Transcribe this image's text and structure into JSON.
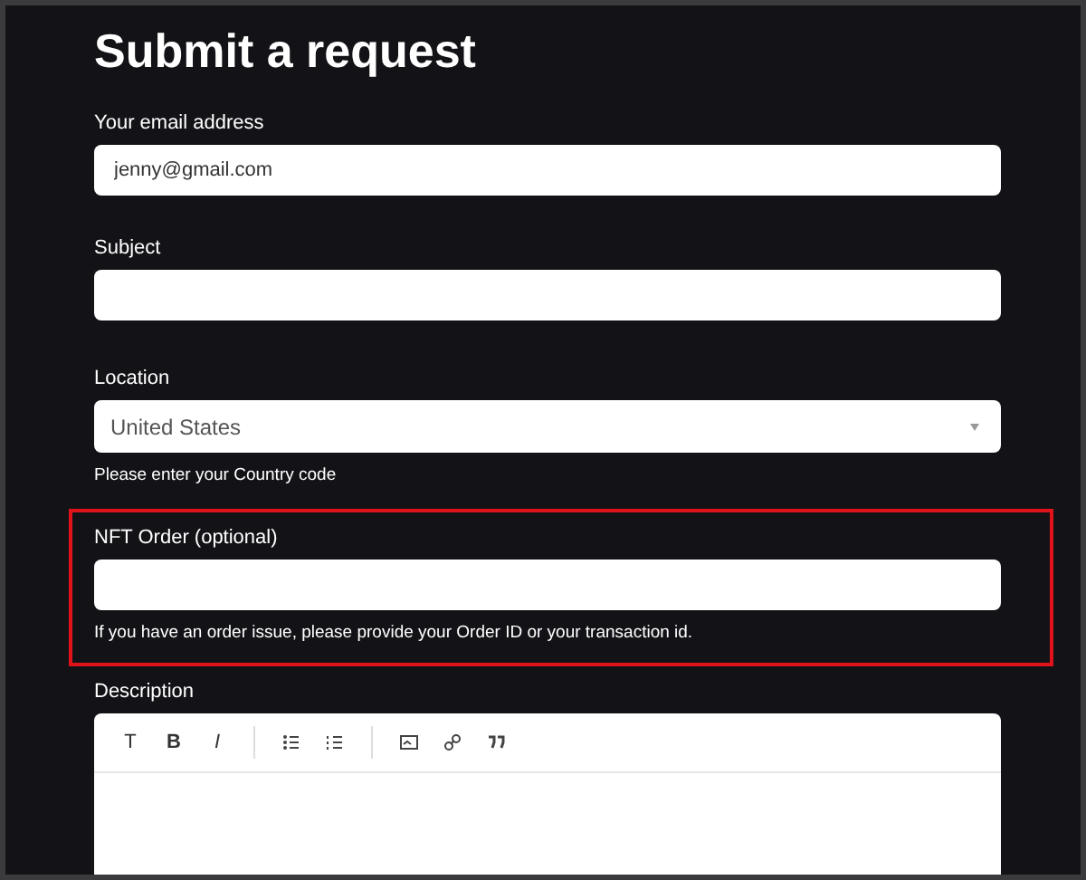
{
  "title": "Submit a request",
  "fields": [
    {
      "kind": "input",
      "label": "Your email address",
      "value": "jenny@gmail.com",
      "highlighted": false
    },
    {
      "kind": "input",
      "label": "Subject",
      "highlighted": false
    },
    {
      "kind": "select",
      "label": "Location",
      "value": "United States",
      "hint": "Please enter your Country code",
      "highlighted": false
    },
    {
      "kind": "input",
      "label": "NFT Order (optional)",
      "hint": "If you have an order issue, please provide your Order ID or your transaction id.",
      "highlighted": true
    },
    {
      "kind": "editor",
      "label": "Description",
      "toolbar_text": [
        "T",
        "B",
        "I"
      ],
      "highlighted": false
    }
  ]
}
